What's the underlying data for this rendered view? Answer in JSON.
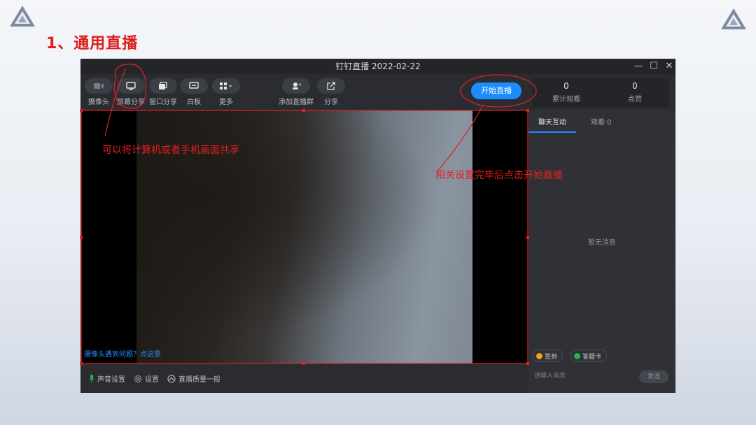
{
  "slide": {
    "title": "1、通用直播"
  },
  "window": {
    "title": "钉钉直播 2022-02-22",
    "controls": {
      "minimize": "—",
      "maximize": "☐",
      "close": "✕"
    }
  },
  "toolbar": {
    "buttons": [
      {
        "label": "摄像头",
        "icon": "camera-icon"
      },
      {
        "label": "屏幕分享",
        "icon": "screen-share-icon"
      },
      {
        "label": "窗口分享",
        "icon": "window-share-icon"
      },
      {
        "label": "白板",
        "icon": "whiteboard-icon"
      },
      {
        "label": "更多",
        "icon": "more-apps-icon"
      },
      {
        "label": "添加直播群",
        "icon": "add-group-icon"
      },
      {
        "label": "分享",
        "icon": "share-icon"
      }
    ],
    "start_label": "开始直播"
  },
  "stats": {
    "views_count": "0",
    "views_label": "累计观看",
    "likes_count": "0",
    "likes_label": "点赞"
  },
  "video": {
    "camera_help": "摄像头遇到问题？点这里"
  },
  "bottombar": {
    "audio": "声音设置",
    "settings": "设置",
    "quality": "直播质量一般"
  },
  "side": {
    "tabs": [
      "聊天互动",
      "观看·0"
    ],
    "empty_text": "暂无消息",
    "chips": [
      "签到",
      "答题卡"
    ],
    "input_placeholder": "请输入消息",
    "send_label": "发送"
  },
  "annotations": {
    "share_note": "可以将计算机或者手机画面共享",
    "start_note": "相关设置完毕后点击开始直播"
  },
  "colors": {
    "annotation_red": "#e42020",
    "accent_blue": "#1c8cff",
    "window_bg": "#2a2c31"
  }
}
